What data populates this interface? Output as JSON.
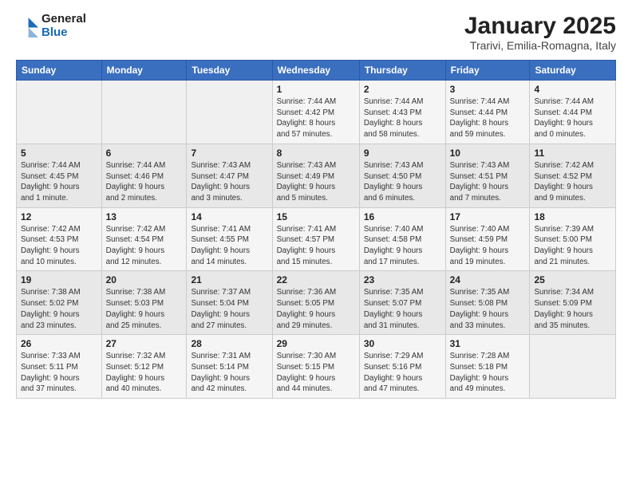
{
  "header": {
    "logo_general": "General",
    "logo_blue": "Blue",
    "title": "January 2025",
    "subtitle": "Trarivi, Emilia-Romagna, Italy"
  },
  "days_of_week": [
    "Sunday",
    "Monday",
    "Tuesday",
    "Wednesday",
    "Thursday",
    "Friday",
    "Saturday"
  ],
  "weeks": [
    [
      {
        "day": "",
        "info": ""
      },
      {
        "day": "",
        "info": ""
      },
      {
        "day": "",
        "info": ""
      },
      {
        "day": "1",
        "info": "Sunrise: 7:44 AM\nSunset: 4:42 PM\nDaylight: 8 hours\nand 57 minutes."
      },
      {
        "day": "2",
        "info": "Sunrise: 7:44 AM\nSunset: 4:43 PM\nDaylight: 8 hours\nand 58 minutes."
      },
      {
        "day": "3",
        "info": "Sunrise: 7:44 AM\nSunset: 4:44 PM\nDaylight: 8 hours\nand 59 minutes."
      },
      {
        "day": "4",
        "info": "Sunrise: 7:44 AM\nSunset: 4:44 PM\nDaylight: 9 hours\nand 0 minutes."
      }
    ],
    [
      {
        "day": "5",
        "info": "Sunrise: 7:44 AM\nSunset: 4:45 PM\nDaylight: 9 hours\nand 1 minute."
      },
      {
        "day": "6",
        "info": "Sunrise: 7:44 AM\nSunset: 4:46 PM\nDaylight: 9 hours\nand 2 minutes."
      },
      {
        "day": "7",
        "info": "Sunrise: 7:43 AM\nSunset: 4:47 PM\nDaylight: 9 hours\nand 3 minutes."
      },
      {
        "day": "8",
        "info": "Sunrise: 7:43 AM\nSunset: 4:49 PM\nDaylight: 9 hours\nand 5 minutes."
      },
      {
        "day": "9",
        "info": "Sunrise: 7:43 AM\nSunset: 4:50 PM\nDaylight: 9 hours\nand 6 minutes."
      },
      {
        "day": "10",
        "info": "Sunrise: 7:43 AM\nSunset: 4:51 PM\nDaylight: 9 hours\nand 7 minutes."
      },
      {
        "day": "11",
        "info": "Sunrise: 7:42 AM\nSunset: 4:52 PM\nDaylight: 9 hours\nand 9 minutes."
      }
    ],
    [
      {
        "day": "12",
        "info": "Sunrise: 7:42 AM\nSunset: 4:53 PM\nDaylight: 9 hours\nand 10 minutes."
      },
      {
        "day": "13",
        "info": "Sunrise: 7:42 AM\nSunset: 4:54 PM\nDaylight: 9 hours\nand 12 minutes."
      },
      {
        "day": "14",
        "info": "Sunrise: 7:41 AM\nSunset: 4:55 PM\nDaylight: 9 hours\nand 14 minutes."
      },
      {
        "day": "15",
        "info": "Sunrise: 7:41 AM\nSunset: 4:57 PM\nDaylight: 9 hours\nand 15 minutes."
      },
      {
        "day": "16",
        "info": "Sunrise: 7:40 AM\nSunset: 4:58 PM\nDaylight: 9 hours\nand 17 minutes."
      },
      {
        "day": "17",
        "info": "Sunrise: 7:40 AM\nSunset: 4:59 PM\nDaylight: 9 hours\nand 19 minutes."
      },
      {
        "day": "18",
        "info": "Sunrise: 7:39 AM\nSunset: 5:00 PM\nDaylight: 9 hours\nand 21 minutes."
      }
    ],
    [
      {
        "day": "19",
        "info": "Sunrise: 7:38 AM\nSunset: 5:02 PM\nDaylight: 9 hours\nand 23 minutes."
      },
      {
        "day": "20",
        "info": "Sunrise: 7:38 AM\nSunset: 5:03 PM\nDaylight: 9 hours\nand 25 minutes."
      },
      {
        "day": "21",
        "info": "Sunrise: 7:37 AM\nSunset: 5:04 PM\nDaylight: 9 hours\nand 27 minutes."
      },
      {
        "day": "22",
        "info": "Sunrise: 7:36 AM\nSunset: 5:05 PM\nDaylight: 9 hours\nand 29 minutes."
      },
      {
        "day": "23",
        "info": "Sunrise: 7:35 AM\nSunset: 5:07 PM\nDaylight: 9 hours\nand 31 minutes."
      },
      {
        "day": "24",
        "info": "Sunrise: 7:35 AM\nSunset: 5:08 PM\nDaylight: 9 hours\nand 33 minutes."
      },
      {
        "day": "25",
        "info": "Sunrise: 7:34 AM\nSunset: 5:09 PM\nDaylight: 9 hours\nand 35 minutes."
      }
    ],
    [
      {
        "day": "26",
        "info": "Sunrise: 7:33 AM\nSunset: 5:11 PM\nDaylight: 9 hours\nand 37 minutes."
      },
      {
        "day": "27",
        "info": "Sunrise: 7:32 AM\nSunset: 5:12 PM\nDaylight: 9 hours\nand 40 minutes."
      },
      {
        "day": "28",
        "info": "Sunrise: 7:31 AM\nSunset: 5:14 PM\nDaylight: 9 hours\nand 42 minutes."
      },
      {
        "day": "29",
        "info": "Sunrise: 7:30 AM\nSunset: 5:15 PM\nDaylight: 9 hours\nand 44 minutes."
      },
      {
        "day": "30",
        "info": "Sunrise: 7:29 AM\nSunset: 5:16 PM\nDaylight: 9 hours\nand 47 minutes."
      },
      {
        "day": "31",
        "info": "Sunrise: 7:28 AM\nSunset: 5:18 PM\nDaylight: 9 hours\nand 49 minutes."
      },
      {
        "day": "",
        "info": ""
      }
    ]
  ]
}
